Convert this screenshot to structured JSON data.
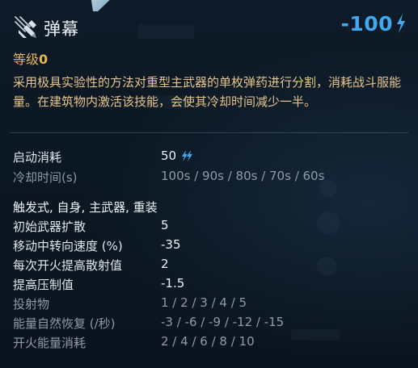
{
  "ability": {
    "icon": "barrage-missiles-icon",
    "title": "弹幕",
    "cost": "-100",
    "cost_icon": "energy-bolt-icon",
    "level_label": "等级",
    "level_value": "0",
    "description": "采用极具实验性的方法对重型主武器的单枚弹药进行分割，消耗战斗服能量。在建筑物内激活该技能，会使其冷却时间减少一半。"
  },
  "stats": {
    "activation_cost": {
      "label": "启动消耗",
      "value": "50",
      "icon": "energy-bolts-icon"
    },
    "cooldown": {
      "label": "冷却时间(s)",
      "value": "100s / 90s / 80s / 70s / 60s"
    },
    "categories": "触发式, 自身, 主武器, 重装",
    "rows": [
      {
        "label": "初始武器扩散",
        "value": "5",
        "style": "bright"
      },
      {
        "label": "移动中转向速度 (%)",
        "value": "-35",
        "style": "bright"
      },
      {
        "label": "每次开火提高散射值",
        "value": "2",
        "style": "bright"
      },
      {
        "label": "提高压制值",
        "value": "-1.5",
        "style": "bright"
      },
      {
        "label": "投射物",
        "value": "1 / 2 / 3 / 4 / 5",
        "style": "dim"
      },
      {
        "label": "能量自然恢复 (/秒)",
        "value": "-3 / -6 / -9 / -12 / -15",
        "style": "dim"
      },
      {
        "label": "开火能量消耗",
        "value": "2 / 4 / 6 / 8 / 10",
        "style": "dim"
      }
    ]
  },
  "colors": {
    "accent_blue": "#41a8ee",
    "level_gold": "#e7b84f",
    "description_text": "#e6c48b",
    "dim_text": "#8e9ba8",
    "bright_text": "#eef3f7"
  }
}
